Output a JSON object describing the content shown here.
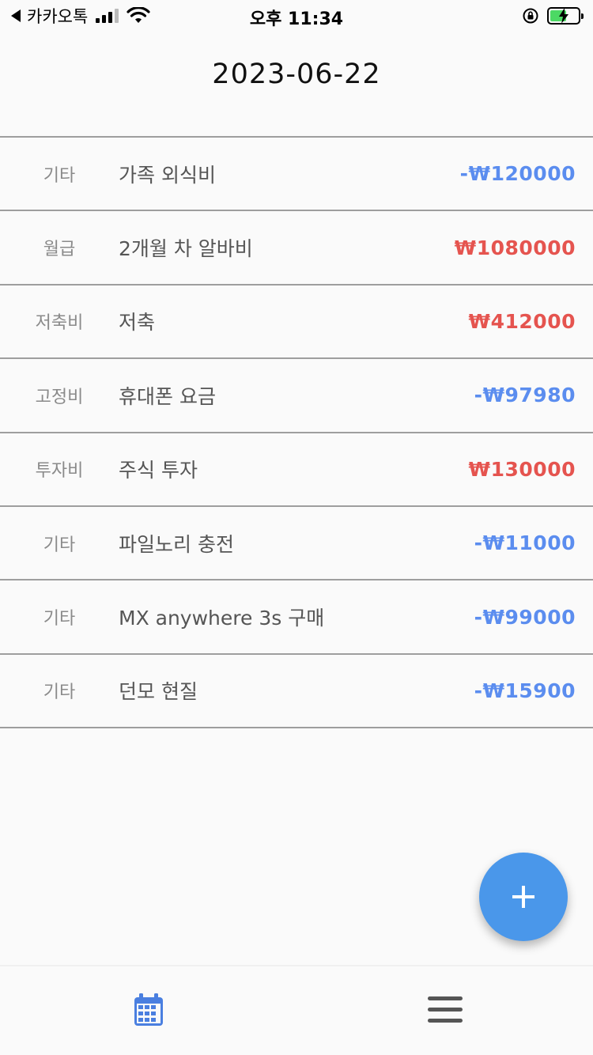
{
  "status_bar": {
    "carrier": "카카오톡",
    "time": "오후 11:34"
  },
  "header": {
    "title": "2023-06-22"
  },
  "transactions": [
    {
      "category": "기타",
      "description": "가족 외식비",
      "amount": "-₩120000",
      "type": "expense"
    },
    {
      "category": "월급",
      "description": "2개월 차 알바비",
      "amount": "₩1080000",
      "type": "income"
    },
    {
      "category": "저축비",
      "description": "저축",
      "amount": "₩412000",
      "type": "income"
    },
    {
      "category": "고정비",
      "description": "휴대폰 요금",
      "amount": "-₩97980",
      "type": "expense"
    },
    {
      "category": "투자비",
      "description": "주식 투자",
      "amount": "₩130000",
      "type": "income"
    },
    {
      "category": "기타",
      "description": "파일노리 충전",
      "amount": "-₩11000",
      "type": "expense"
    },
    {
      "category": "기타",
      "description": "MX anywhere 3s 구매",
      "amount": "-₩99000",
      "type": "expense"
    },
    {
      "category": "기타",
      "description": "던모 현질",
      "amount": "-₩15900",
      "type": "expense"
    }
  ],
  "colors": {
    "expense": "#5b8def",
    "income": "#e5544f",
    "fab": "#4a97ea",
    "nav_active": "#4a7fe0",
    "nav_inactive": "#555555"
  },
  "icons": {
    "fab": "plus-icon",
    "nav_left": "calendar-icon",
    "nav_right": "menu-icon"
  }
}
